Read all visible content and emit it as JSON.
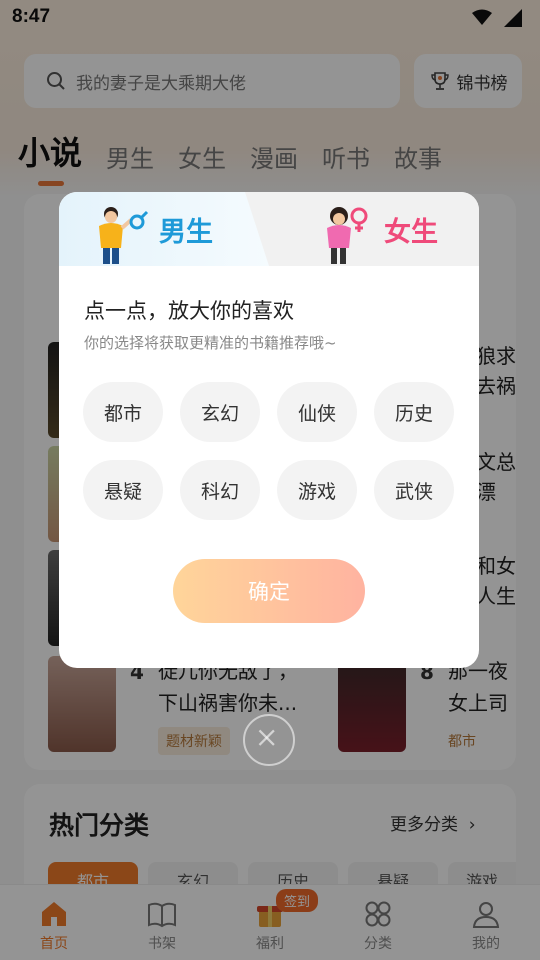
{
  "status_bar": {
    "time": "8:47"
  },
  "header": {
    "search_placeholder": "我的妻子是大乘期大佬",
    "rank_label": "锦书榜"
  },
  "tabs": [
    {
      "label": "小说",
      "active": true
    },
    {
      "label": "男生"
    },
    {
      "label": "女生"
    },
    {
      "label": "漫画"
    },
    {
      "label": "听书"
    },
    {
      "label": "故事"
    }
  ],
  "background_list": {
    "items": [
      {
        "rank": "4",
        "title_line1": "徒儿你无敌了，",
        "title_line2": "下山祸害你未...",
        "tag": "题材新颖"
      },
      {
        "rank": "8",
        "title_line1": "那一夜",
        "title_line2": "女上司",
        "tag": "都市"
      }
    ],
    "side_fragments": [
      "狼求",
      "去祸",
      "文总",
      "漂",
      "和女",
      "人生"
    ]
  },
  "hot_categories": {
    "title": "热门分类",
    "more": "更多分类",
    "chips": [
      "都市",
      "玄幻",
      "历史",
      "悬疑",
      "游戏"
    ]
  },
  "bottom_nav": {
    "items": [
      {
        "label": "首页",
        "icon": "home-icon",
        "active": true
      },
      {
        "label": "书架",
        "icon": "bookshelf-icon"
      },
      {
        "label": "福利",
        "icon": "gift-icon",
        "badge": "签到"
      },
      {
        "label": "分类",
        "icon": "category-icon"
      },
      {
        "label": "我的",
        "icon": "profile-icon"
      }
    ]
  },
  "dialog": {
    "male_label": "男生",
    "female_label": "女生",
    "title": "点一点，放大你的喜欢",
    "subtitle": "你的选择将获取更精准的书籍推荐哦~",
    "genres": [
      "都市",
      "玄幻",
      "仙侠",
      "历史",
      "悬疑",
      "科幻",
      "游戏",
      "武侠"
    ],
    "confirm": "确定"
  },
  "colors": {
    "accent": "#f07a2a",
    "male": "#1e9ad8",
    "female": "#ef4a7a"
  }
}
